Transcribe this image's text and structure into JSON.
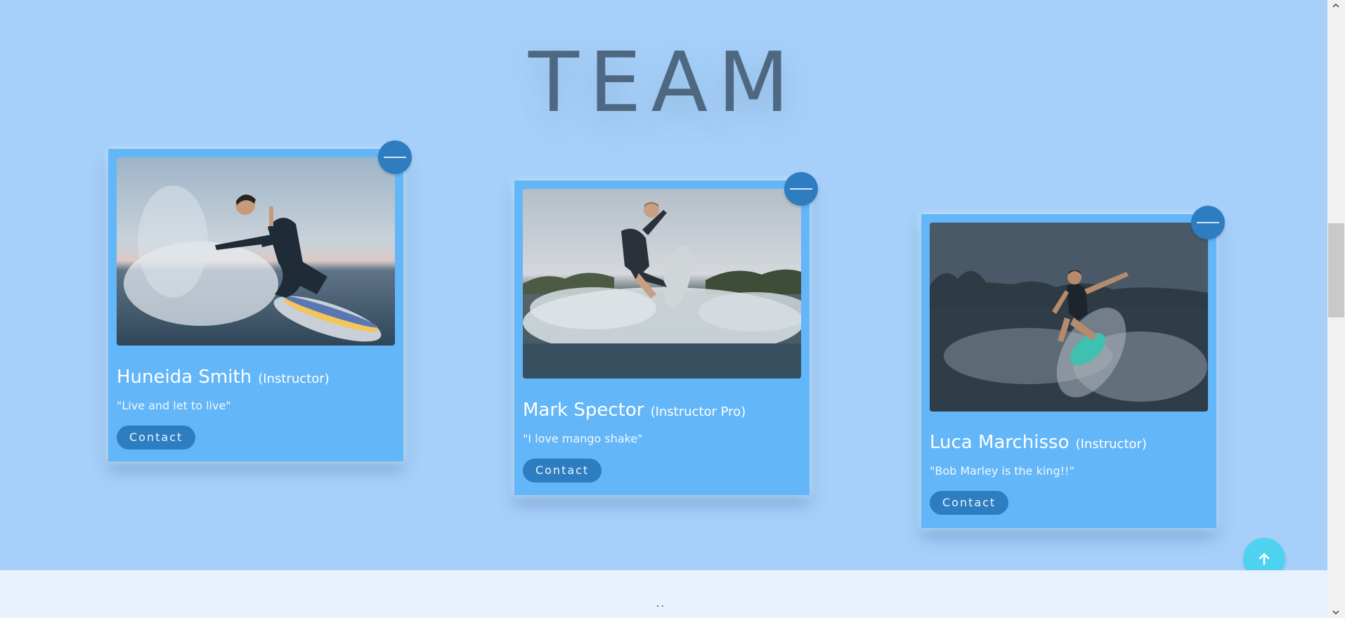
{
  "page": {
    "top_marker": ".",
    "title": "TEAM",
    "footer_marker": ".."
  },
  "team": [
    {
      "name": "Huneida Smith",
      "role": "(Instructor)",
      "quote": "\"Live and let to live\"",
      "contact_label": "Contact",
      "photo": "surfer-woman-crouching-on-wave"
    },
    {
      "name": "Mark Spector",
      "role": "(Instructor Pro)",
      "quote": "\"I love mango shake\"",
      "contact_label": "Contact",
      "photo": "surfer-man-jumping-wake"
    },
    {
      "name": "Luca Marchisso",
      "role": "(Instructor)",
      "quote": "\"Bob Marley is the king!!\"",
      "contact_label": "Contact",
      "photo": "surfer-man-carving-at-dusk"
    }
  ],
  "colors": {
    "background": "#a6d0f9",
    "card": "#63b6f8",
    "accent": "#2e7dc0",
    "title": "#4f6882",
    "back_to_top": "#4fd1f0",
    "footer": "#e7f2fc"
  },
  "icons": {
    "toggle": "minus-icon",
    "back_to_top": "arrow-up-icon"
  }
}
